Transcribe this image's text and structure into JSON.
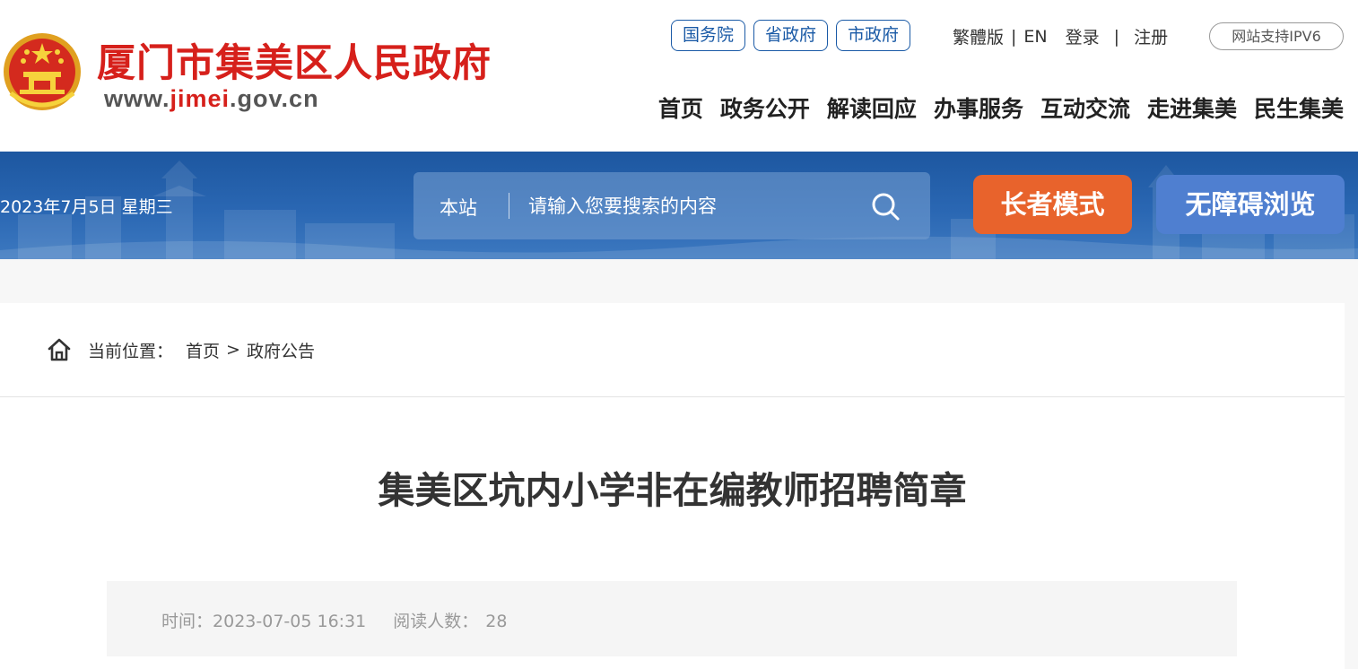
{
  "header": {
    "site_name": "厦门市集美区人民政府",
    "domain_prefix": "www.",
    "domain_highlight": "jimei",
    "domain_suffix": ".gov.cn",
    "gov_links": [
      "国务院",
      "省政府",
      "市政府"
    ],
    "traditional": "繁體版",
    "english": "EN",
    "login": "登录",
    "register": "注册",
    "separator": "|",
    "ipv6_badge": "网站支持IPV6",
    "nav": [
      "首页",
      "政务公开",
      "解读回应",
      "办事服务",
      "互动交流",
      "走进集美",
      "民生集美"
    ]
  },
  "banner": {
    "date": "2023年7月5日 星期三",
    "search_scope": "本站",
    "search_placeholder": "请输入您要搜索的内容",
    "elder_mode": "长者模式",
    "accessible": "无障碍浏览"
  },
  "breadcrumb": {
    "label": "当前位置：",
    "home": "首页",
    "arrow": ">",
    "current": "政府公告"
  },
  "article": {
    "title": "集美区坑内小学非在编教师招聘简章",
    "time_label": "时间：",
    "time_value": "2023-07-05 16:31",
    "reads_label": "阅读人数：",
    "reads_value": "28"
  },
  "colors": {
    "brand_red": "#d6201b",
    "link_blue": "#1a5aa6",
    "banner_blue": "#1d57a0",
    "elder_orange": "#e8632c",
    "access_blue": "#4f7fd0"
  }
}
